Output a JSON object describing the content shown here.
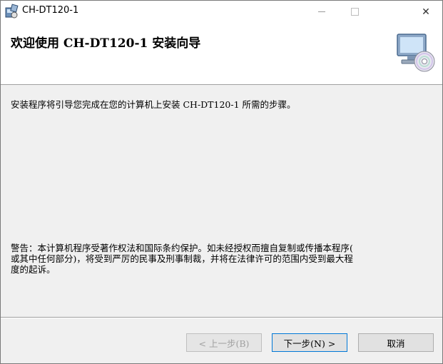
{
  "window": {
    "title": "CH-DT120-1",
    "close_glyph": "✕"
  },
  "banner": {
    "heading": "欢迎使用 CH-DT120-1 安装向导",
    "art_icon": "computer-cd-icon"
  },
  "content": {
    "intro": "安装程序将引导您完成在您的计算机上安装 CH-DT120-1 所需的步骤。",
    "warning_lines": [
      "警告：本计算机程序受著作权法和国际条约保护。如未经授权而擅自复制或传播本程序(",
      "或其中任何部分)，将受到严厉的民事及刑事制裁，并将在法律许可的范围内受到最大程",
      "度的起诉。"
    ]
  },
  "buttons": {
    "back": "< 上一步(B)",
    "next": "下一步(N) >",
    "cancel": "取消"
  },
  "colors": {
    "accent": "#0078d7",
    "banner_bg": "#ffffff",
    "body_bg": "#f0f0f0"
  }
}
